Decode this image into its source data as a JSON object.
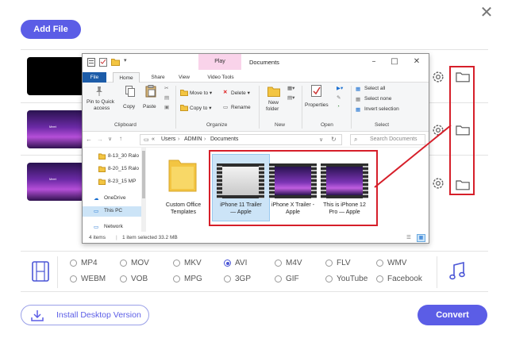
{
  "top": {
    "add_file_label": "Add File",
    "close_glyph": "✕"
  },
  "rows_icons": {
    "gear": "gear-icon",
    "folder": "folder-icon"
  },
  "thumb_text": "Meet",
  "explorer": {
    "title": "Documents",
    "context_tab": "Play",
    "tabs": [
      "File",
      "Home",
      "Share",
      "View",
      "Video Tools"
    ],
    "ribbon": {
      "pin": [
        "Pin to Quick",
        "access"
      ],
      "copy": "Copy",
      "paste": "Paste",
      "move_to": "Move to",
      "copy_to": "Copy to",
      "delete": "Delete",
      "rename": "Rename",
      "new_folder": [
        "New",
        "folder"
      ],
      "properties": "Properties",
      "select_all": "Select all",
      "select_none": "Select none",
      "invert_selection": "Invert selection",
      "groups": [
        "Clipboard",
        "Organize",
        "New",
        "Open",
        "Select"
      ]
    },
    "address": {
      "chevrons": "«",
      "path": [
        "Users",
        "ADMIN",
        "Documents"
      ],
      "search_placeholder": "Search Documents"
    },
    "nav": [
      "8-13_30 Ralo",
      "8-20_15 Ralo",
      "8-23_15 MP",
      "OneDrive",
      "This PC",
      "Network"
    ],
    "files": [
      {
        "name": [
          "Custom Office",
          "Templates"
        ]
      },
      {
        "name": [
          "iPhone 11 Trailer",
          "— Apple"
        ]
      },
      {
        "name": [
          "iPhone X Trailer -",
          "Apple"
        ]
      },
      {
        "name": [
          "This is iPhone 12",
          "Pro — Apple"
        ]
      }
    ],
    "status": {
      "items": "4 items",
      "selected": "1 item selected  33.2 MB"
    }
  },
  "formats": {
    "row1": [
      "MP4",
      "MOV",
      "MKV",
      "AVI",
      "M4V",
      "FLV",
      "WMV"
    ],
    "row2": [
      "WEBM",
      "VOB",
      "MPG",
      "3GP",
      "GIF",
      "YouTube",
      "Facebook"
    ],
    "selected": "AVI"
  },
  "bottom": {
    "install_label": "Install Desktop Version",
    "convert_label": "Convert"
  },
  "colors": {
    "accent": "#5b5de6",
    "highlight": "#d61f2a",
    "file_tab": "#1c5ca8",
    "context_tab": "#f9d3ea"
  }
}
